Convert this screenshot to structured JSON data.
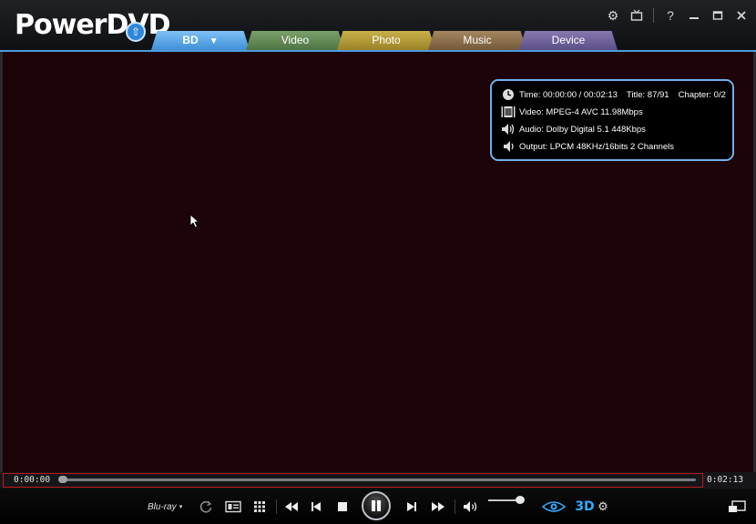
{
  "app": {
    "logo_text": "PowerDVD"
  },
  "window_controls": {
    "settings_icon": "gear-icon",
    "tv_icon": "tv-icon",
    "help_label": "?",
    "minimize_icon": "minimize-icon",
    "maximize_icon": "maximize-icon",
    "close_icon": "close-icon"
  },
  "tabs": [
    {
      "label": "BD",
      "active": true,
      "color": "#4a9be0"
    },
    {
      "label": "Video",
      "color": "#5c8750"
    },
    {
      "label": "Photo",
      "color": "#ad962f"
    },
    {
      "label": "Music",
      "color": "#846945"
    },
    {
      "label": "Device",
      "color": "#6a5c98"
    }
  ],
  "info_panel": {
    "time": "Time: 00:00:00 / 00:02:13",
    "title": "Title: 87/91",
    "chapter": "Chapter: 0/2",
    "video": "Video: MPEG-4 AVC  11.98Mbps",
    "audio": "Audio: Dolby Digital 5.1   448Kbps",
    "output": "Output: LPCM 48KHz/16bits  2 Channels"
  },
  "seek": {
    "current_time": "0:00:00",
    "total_time": "0:02:13",
    "progress_fraction": 0.0
  },
  "controls": {
    "source_label": "Blu-ray",
    "source_dropdown": "▾",
    "three_d_label": "3D",
    "volume_fraction": 0.85
  },
  "colors": {
    "accent": "#4d9ce0",
    "video_bg": "#1c0408",
    "highlight_border": "#c0161c",
    "three_d": "#35a9ff"
  }
}
